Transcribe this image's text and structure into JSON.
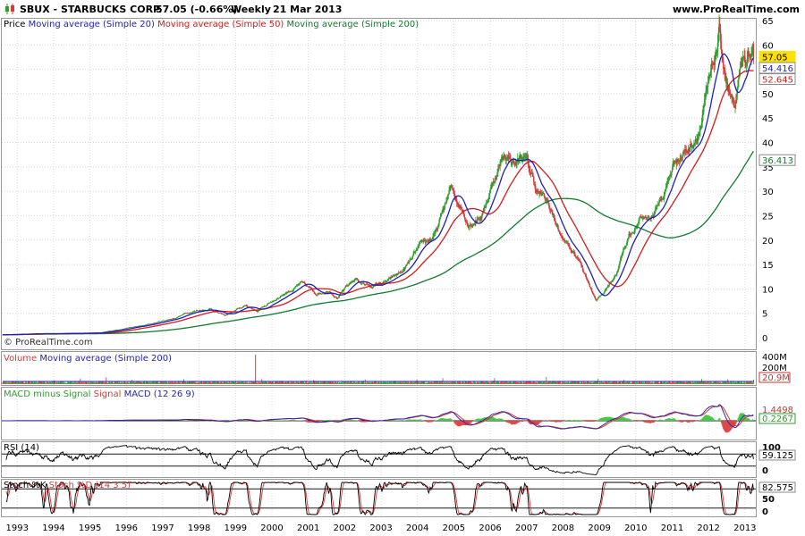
{
  "header": {
    "symbol_text": "SBUX - STARBUCKS CORP.",
    "price_text": "57.05 (-0.66%)",
    "period": "Weekly",
    "date": "21 Mar 2013",
    "site": "www.ProRealTime.com"
  },
  "watermark": "© ProRealTime.com",
  "colors": {
    "up_candle": "#2e9e2e",
    "down_candle": "#d23c3c",
    "ma20": "#1f1fb8",
    "ma50": "#d01c1c",
    "ma200": "#127a2e",
    "signal": "#e03030",
    "macd": "#2a2aa8",
    "hist_pos": "#48c848",
    "hist_neg": "#e04848",
    "grid": "#d9d9d9",
    "level_line": "#1a1a1a"
  },
  "panels": {
    "price": {
      "legend": [
        "Price",
        "Moving average (Simple 20)",
        "Moving average (Simple 50)",
        "Moving average (Simple 200)"
      ],
      "ticks": [
        "65",
        "60",
        "55",
        "50",
        "45",
        "40",
        "35",
        "30",
        "25",
        "20",
        "15",
        "10",
        "5",
        "0"
      ],
      "last_labels": [
        "57.05",
        "54.416",
        "52.645",
        "36.413"
      ]
    },
    "volume": {
      "legend": [
        "Volume",
        "Moving average (Simple 200)"
      ],
      "ticks": [
        "400M",
        "200M"
      ],
      "last_label": "20.9M"
    },
    "macd": {
      "legend": [
        "MACD minus Signal",
        "Signal",
        "MACD (12 26 9)"
      ],
      "last_labels": [
        "1.4498",
        "0.2267"
      ]
    },
    "rsi": {
      "legend": [
        "RSI (14)"
      ],
      "ticks": [
        "100",
        "50",
        "0"
      ],
      "last_label": "59.125"
    },
    "stoch": {
      "legend": [
        "Stoch %K",
        "Stoch %D",
        "(14 3 5)"
      ],
      "ticks": [
        "100",
        "50",
        "0"
      ],
      "last_label": "82.575"
    }
  },
  "years": [
    "1993",
    "1994",
    "1995",
    "1996",
    "1997",
    "1998",
    "1999",
    "2000",
    "2001",
    "2002",
    "2003",
    "2004",
    "2005",
    "2006",
    "2007",
    "2008",
    "2009",
    "2010",
    "2011",
    "2012",
    "2013"
  ],
  "chart_data": {
    "type": "line",
    "title": "SBUX - STARBUCKS CORP. Weekly",
    "x_unit": "year",
    "ylim": [
      0,
      65
    ],
    "price_anchors": [
      [
        1992.6,
        0.6
      ],
      [
        1993.5,
        0.8
      ],
      [
        1994.5,
        0.9
      ],
      [
        1995.3,
        1.0
      ],
      [
        1996.0,
        2.0
      ],
      [
        1996.5,
        2.5
      ],
      [
        1997.3,
        4.0
      ],
      [
        1997.8,
        5.5
      ],
      [
        1998.3,
        6.0
      ],
      [
        1998.7,
        4.5
      ],
      [
        1999.3,
        6.5
      ],
      [
        1999.6,
        5.5
      ],
      [
        2000.0,
        7.5
      ],
      [
        2000.4,
        9.5
      ],
      [
        2000.8,
        11.0
      ],
      [
        2001.2,
        9.0
      ],
      [
        2001.6,
        10.0
      ],
      [
        2001.8,
        8.5
      ],
      [
        2002.3,
        12.0
      ],
      [
        2002.7,
        10.5
      ],
      [
        2003.2,
        11.5
      ],
      [
        2003.6,
        13.5
      ],
      [
        2004.0,
        17.5
      ],
      [
        2004.5,
        21.0
      ],
      [
        2004.9,
        30.0
      ],
      [
        2005.2,
        27.0
      ],
      [
        2005.4,
        24.0
      ],
      [
        2005.8,
        26.0
      ],
      [
        2006.1,
        33.0
      ],
      [
        2006.4,
        38.0
      ],
      [
        2006.7,
        36.0
      ],
      [
        2006.9,
        37.5
      ],
      [
        2007.3,
        30.0
      ],
      [
        2007.6,
        27.0
      ],
      [
        2008.0,
        20.0
      ],
      [
        2008.5,
        15.0
      ],
      [
        2008.9,
        8.0
      ],
      [
        2009.1,
        9.0
      ],
      [
        2009.5,
        14.0
      ],
      [
        2009.8,
        21.0
      ],
      [
        2010.1,
        24.0
      ],
      [
        2010.5,
        25.5
      ],
      [
        2010.8,
        30.0
      ],
      [
        2011.1,
        37.0
      ],
      [
        2011.5,
        39.5
      ],
      [
        2011.8,
        45.0
      ],
      [
        2012.1,
        53.0
      ],
      [
        2012.3,
        61.0
      ],
      [
        2012.5,
        52.0
      ],
      [
        2012.7,
        45.0
      ],
      [
        2012.9,
        53.0
      ],
      [
        2013.1,
        57.0
      ],
      [
        2013.22,
        57.05
      ]
    ],
    "series": [
      {
        "name": "Moving average (Simple 20)",
        "last_value": 54.416
      },
      {
        "name": "Moving average (Simple 50)",
        "last_value": 52.645
      },
      {
        "name": "Moving average (Simple 200)",
        "last_value": 36.413
      }
    ],
    "indicators": {
      "volume_last": "20.9M",
      "macd_last": 1.4498,
      "macd_hist_last": 0.2267,
      "rsi_last": 59.125,
      "stoch_last": 82.575
    }
  }
}
